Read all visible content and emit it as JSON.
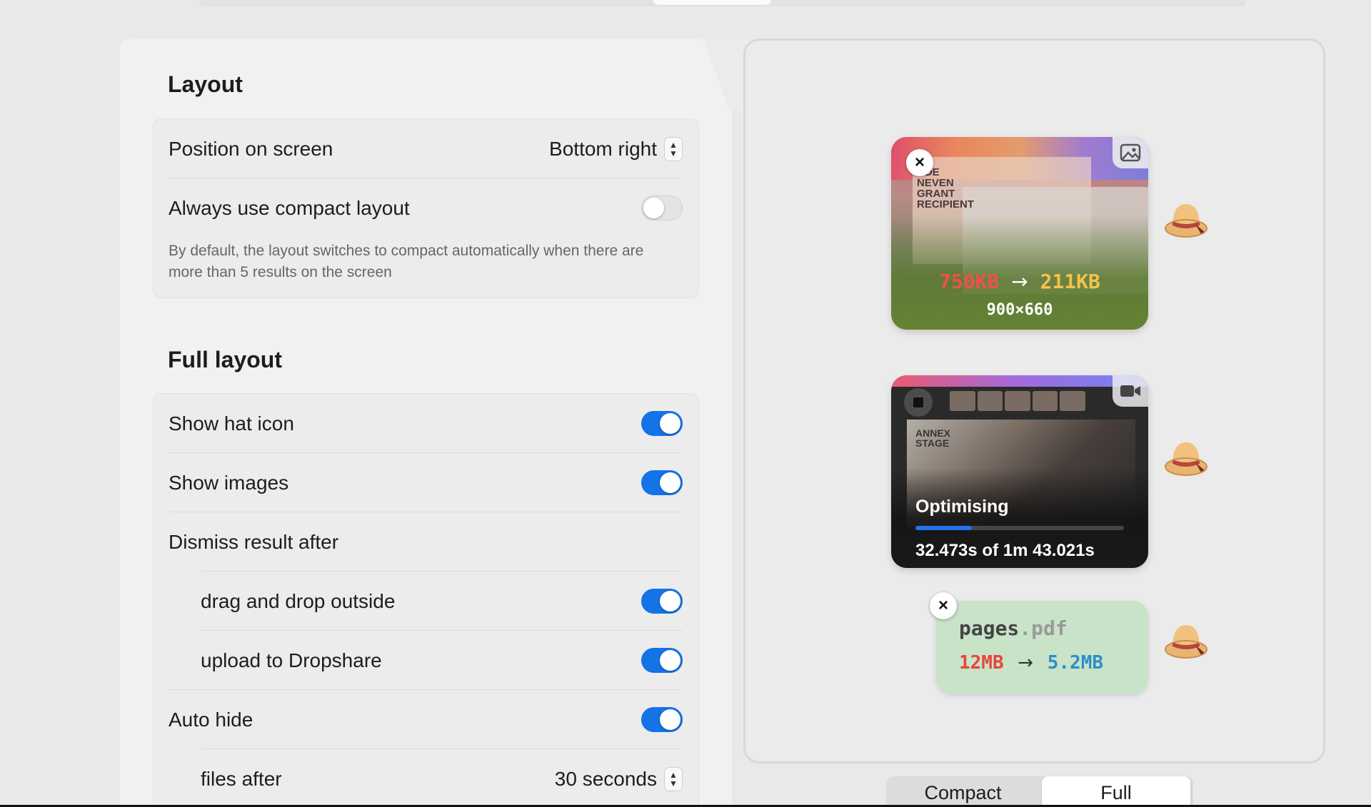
{
  "layout_section": {
    "title": "Layout",
    "position_label": "Position on screen",
    "position_value": "Bottom right",
    "compact_label": "Always use compact layout",
    "compact_enabled": false,
    "compact_desc": "By default, the layout switches to compact automatically when there are more than 5 results on the screen"
  },
  "full_section": {
    "title": "Full layout",
    "rows": [
      {
        "label": "Show hat icon",
        "enabled": true
      },
      {
        "label": "Show images",
        "enabled": true
      },
      {
        "label": "Dismiss result after"
      },
      {
        "label": "drag and drop outside",
        "enabled": true
      },
      {
        "label": "upload to Dropshare",
        "enabled": true
      },
      {
        "label": "Auto hide",
        "enabled": true
      },
      {
        "label": "files after",
        "value": "30 seconds"
      }
    ]
  },
  "preview": {
    "image_card": {
      "old_size": "750KB",
      "arrow": "→",
      "new_size": "211KB",
      "dimensions": "900×660",
      "headline": "ADE NEVEN GRANT RECIPIENT",
      "old_color": "#f0504a",
      "new_color": "#f5c24a"
    },
    "video_card": {
      "status": "Optimising",
      "progress": 0.27,
      "time": "32.473s of 1m 43.021s",
      "screen_label": "ANNEX STAGE"
    },
    "pdf_card": {
      "basename": "pages",
      "ext": ".pdf",
      "old_size": "12MB",
      "arrow": "→",
      "new_size": "5.2MB",
      "old_color": "#e8453c",
      "new_color": "#2b8fc8"
    }
  },
  "segmented": {
    "compact": "Compact",
    "full": "Full",
    "selected": "Full"
  },
  "colors": {
    "accent": "#1473e6",
    "panel": "#f1f1f1"
  },
  "icons": {
    "close": "×",
    "stepper_up": "▲",
    "stepper_down": "▼"
  }
}
